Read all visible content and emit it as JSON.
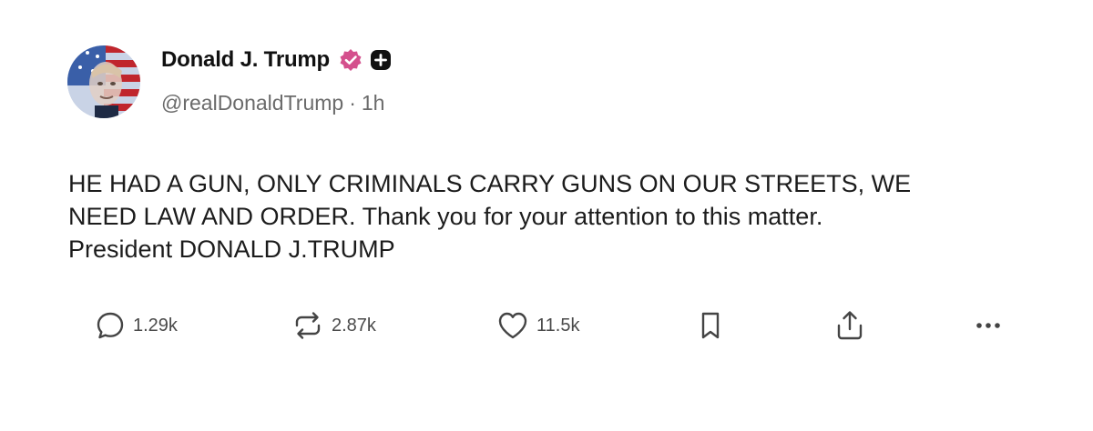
{
  "post": {
    "author": {
      "display_name": "Donald J. Trump",
      "handle": "@realDonaldTrump",
      "separator": "·",
      "time": "1h",
      "verified_badge": "verified-check-icon",
      "plus_badge": "plus-badge-icon",
      "verified_color": "#d4508d"
    },
    "body_lines": [
      "HE HAD A GUN, ONLY CRIMINALS CARRY GUNS ON OUR STREETS, WE",
      "NEED LAW AND ORDER. Thank you for your attention to this matter.",
      "President DONALD J.TRUMP"
    ],
    "actions": {
      "replies": {
        "icon": "reply-icon",
        "count": "1.29k"
      },
      "reposts": {
        "icon": "repost-icon",
        "count": "2.87k"
      },
      "likes": {
        "icon": "heart-icon",
        "count": "11.5k"
      },
      "bookmark": {
        "icon": "bookmark-icon"
      },
      "share": {
        "icon": "share-icon"
      },
      "more": {
        "icon": "more-icon"
      }
    }
  }
}
